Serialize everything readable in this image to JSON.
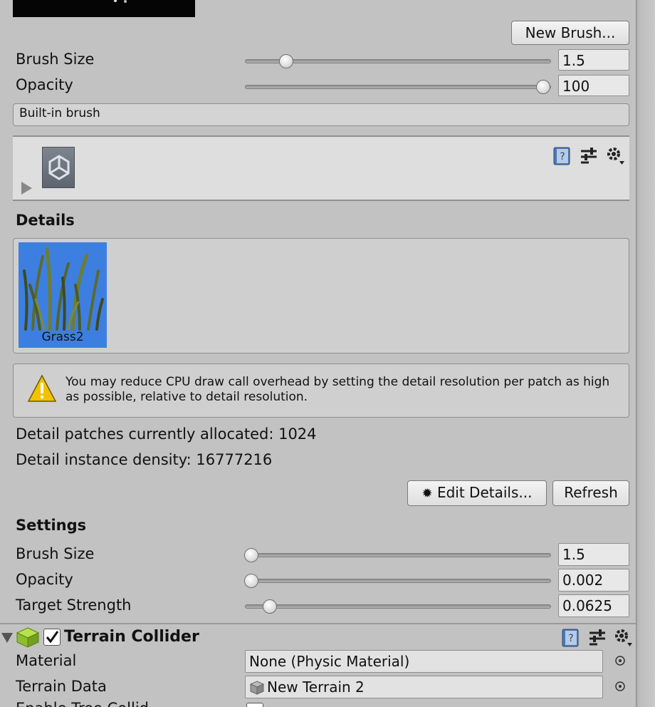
{
  "brush": {
    "new_brush_label": "New Brush...",
    "size_label": "Brush Size",
    "size_value": "1.5",
    "size_level": 0.12,
    "opacity_label": "Opacity",
    "opacity_value": "100",
    "opacity_level": 1.0,
    "brush_name": "Built-in brush"
  },
  "details": {
    "heading": "Details",
    "items": [
      {
        "label": "Grass2",
        "selected": true
      }
    ],
    "warning": "You may reduce CPU draw call overhead by setting the detail resolution per patch as high as possible, relative to detail resolution.",
    "patches_text": "Detail patches currently allocated: 1024",
    "density_text": "Detail instance density: 16777216",
    "edit_label": "Edit Details...",
    "refresh_label": "Refresh"
  },
  "settings": {
    "heading": "Settings",
    "brush_size_label": "Brush Size",
    "brush_size_value": "1.5",
    "brush_size_level": 0.0,
    "opacity_label": "Opacity",
    "opacity_value": "0.002",
    "opacity_level": 0.0,
    "target_strength_label": "Target Strength",
    "target_strength_value": "0.0625",
    "target_strength_level": 0.0625
  },
  "collider": {
    "title": "Terrain Collider",
    "enabled": true,
    "material_label": "Material",
    "material_value": "None (Physic Material)",
    "terrain_data_label": "Terrain Data",
    "terrain_data_value": "New Terrain 2",
    "enable_tree_label": "Enable Tree Collid"
  },
  "colors": {
    "panel_bg": "#c2c2c2",
    "selection_blue": "#3d7fe0",
    "warning_yellow": "#f2c200"
  }
}
